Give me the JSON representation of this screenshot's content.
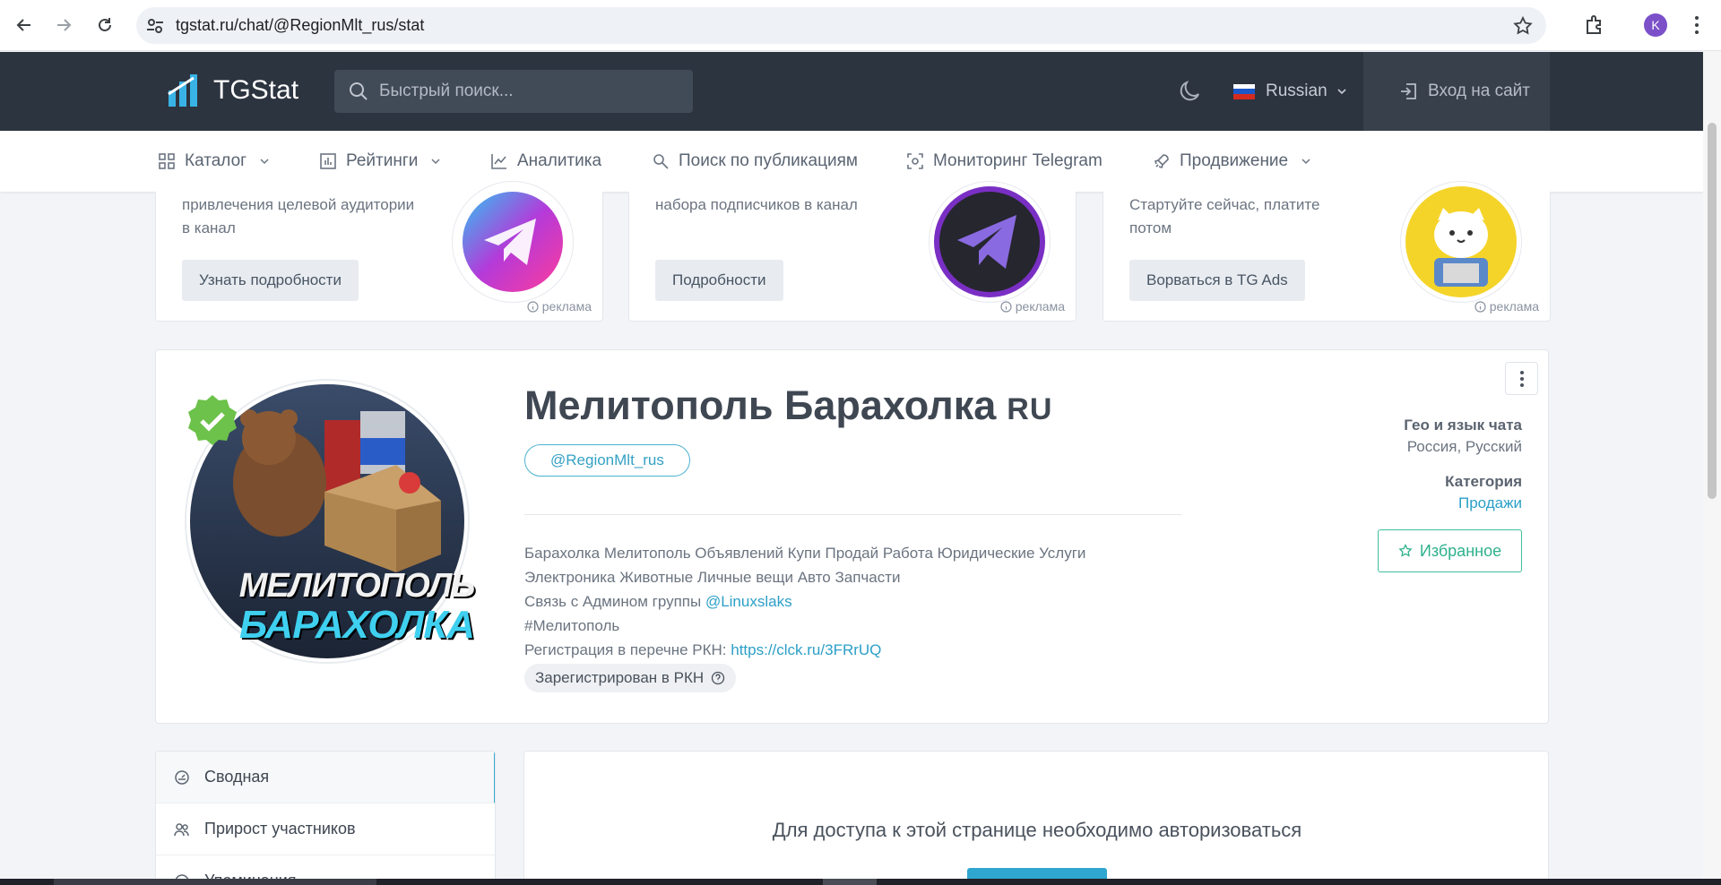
{
  "browser": {
    "url": "tgstat.ru/chat/@RegionMlt_rus/stat",
    "profile_initial": "K"
  },
  "header": {
    "logo_text": "TGStat",
    "search_placeholder": "Быстрый поиск...",
    "language": "Russian",
    "login_label": "Вход на сайт"
  },
  "nav": {
    "items": [
      {
        "label": "Каталог",
        "icon": "grid-icon",
        "dropdown": true
      },
      {
        "label": "Рейтинги",
        "icon": "bar-chart-icon",
        "dropdown": true
      },
      {
        "label": "Аналитика",
        "icon": "line-chart-icon",
        "dropdown": false
      },
      {
        "label": "Поиск по публикациям",
        "icon": "search-doc-icon",
        "dropdown": false
      },
      {
        "label": "Мониторинг Telegram",
        "icon": "scan-icon",
        "dropdown": false
      },
      {
        "label": "Продвижение",
        "icon": "rocket-icon",
        "dropdown": true
      }
    ]
  },
  "ads": [
    {
      "desc": "привлечения целевой аудитории в канал",
      "button": "Узнать подробности",
      "mark": "реклама"
    },
    {
      "desc": "набора подписчиков в канал",
      "button": "Подробности",
      "mark": "реклама"
    },
    {
      "desc": "Стартуйте сейчас, платите потом",
      "button": "Ворваться в TG Ads",
      "mark": "реклама"
    }
  ],
  "channel": {
    "title": "Мелитополь Барахолка",
    "title_suffix": "RU",
    "handle": "@RegionMlt_rus",
    "avatar_line1": "МЕЛИТОПОЛЬ",
    "avatar_line2": "БАРАХОЛКА",
    "about_line1": "Барахолка Мелитополь Объявлений Купи Продай Работа Юридические Услуги",
    "about_line2": "Электроника Животные Личные вещи Авто Запчасти",
    "about_line3_prefix": "Связь с Админом группы ",
    "about_line3_link": "@Linuxslaks",
    "about_line4": "#Мелитополь",
    "about_line5_prefix": "Регистрация в перечне РКН: ",
    "about_line5_link": "https://clck.ru/3FRrUQ",
    "rkn_badge": "Зарегистрирован в РКН",
    "geo_heading": "Гео и язык чата",
    "geo_value": "Россия, Русский",
    "category_heading": "Категория",
    "category_value": "Продажи",
    "favorite_label": "Избранное"
  },
  "sidebar": {
    "items": [
      {
        "label": "Сводная",
        "active": true
      },
      {
        "label": "Прирост участников",
        "active": false
      },
      {
        "label": "Упоминания",
        "active": false
      }
    ]
  },
  "main": {
    "auth_message": "Для доступа к этой странице необходимо авторизоваться"
  },
  "colors": {
    "header_bg": "#2c3440",
    "accent": "#2fa6cf",
    "favorite": "#2fb18c"
  }
}
